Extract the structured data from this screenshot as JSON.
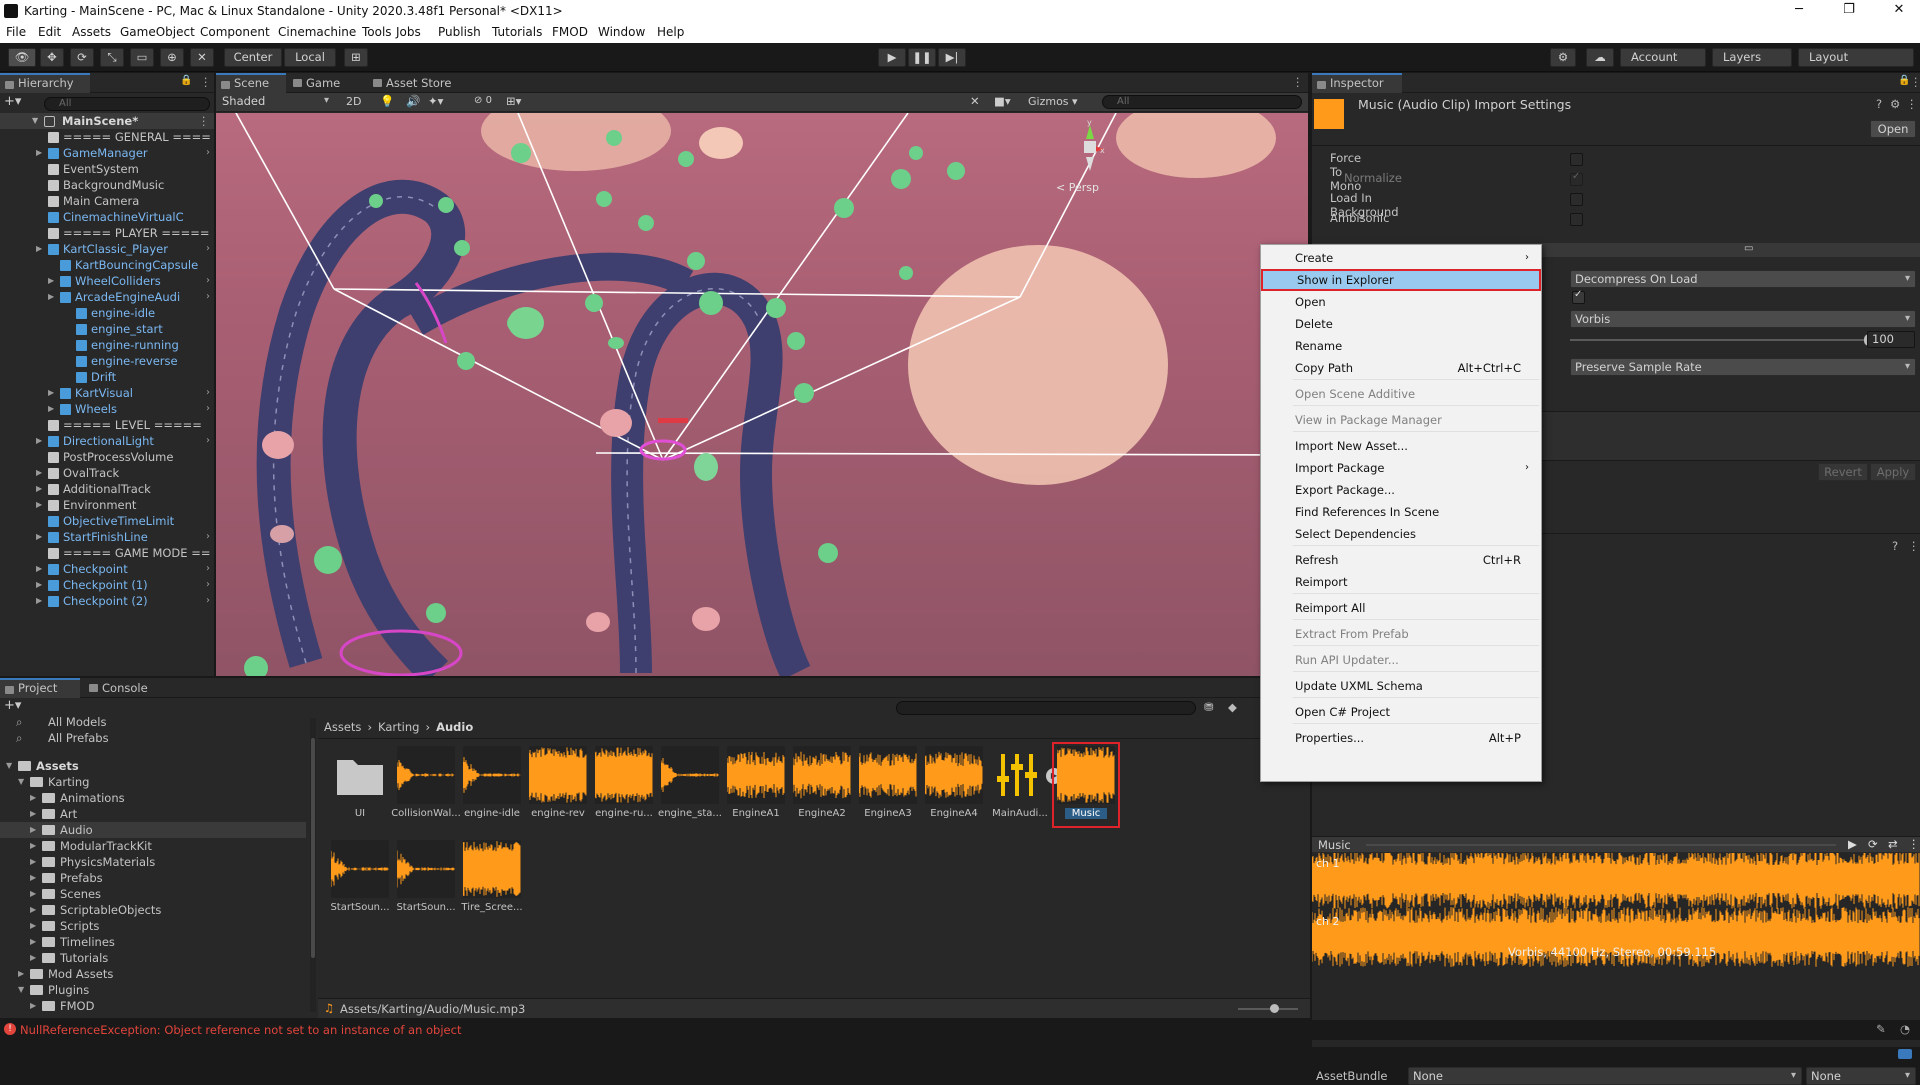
{
  "window": {
    "title": "Karting - MainScene - PC, Mac & Linux Standalone - Unity 2020.3.48f1 Personal* <DX11>"
  },
  "menu": [
    "File",
    "Edit",
    "Assets",
    "GameObject",
    "Component",
    "Cinemachine",
    "Tools",
    "Jobs",
    "Publish",
    "Tutorials",
    "FMOD",
    "Window",
    "Help"
  ],
  "toolbar": {
    "center": "Center",
    "local": "Local",
    "account": "Account",
    "layers": "Layers",
    "layout": "Layout"
  },
  "hierarchy": {
    "tab": "Hierarchy",
    "search": "All",
    "scene": "MainScene*",
    "items": [
      {
        "label": "===== GENERAL ====",
        "indent": 1,
        "icon": "g",
        "blue": false,
        "arrow": false
      },
      {
        "label": "GameManager",
        "indent": 1,
        "icon": "b",
        "blue": true,
        "arrow": true
      },
      {
        "label": "EventSystem",
        "indent": 1,
        "icon": "g",
        "blue": false,
        "arrow": false
      },
      {
        "label": "BackgroundMusic",
        "indent": 1,
        "icon": "g",
        "blue": false,
        "arrow": false
      },
      {
        "label": "Main Camera",
        "indent": 1,
        "icon": "g",
        "blue": false,
        "arrow": false
      },
      {
        "label": "CinemachineVirtualC",
        "indent": 1,
        "icon": "b",
        "blue": true,
        "arrow": false
      },
      {
        "label": "===== PLAYER =====",
        "indent": 1,
        "icon": "g",
        "blue": false,
        "arrow": false
      },
      {
        "label": "KartClassic_Player",
        "indent": 1,
        "icon": "b",
        "blue": true,
        "arrow": true
      },
      {
        "label": "KartBouncingCapsule",
        "indent": 2,
        "icon": "b",
        "blue": true,
        "arrow": false
      },
      {
        "label": "WheelColliders",
        "indent": 2,
        "icon": "b",
        "blue": true,
        "arrow": true
      },
      {
        "label": "ArcadeEngineAudi",
        "indent": 2,
        "icon": "b",
        "blue": true,
        "arrow": true
      },
      {
        "label": "engine-idle",
        "indent": 3,
        "icon": "b",
        "blue": true,
        "arrow": false
      },
      {
        "label": "engine_start",
        "indent": 3,
        "icon": "b",
        "blue": true,
        "arrow": false
      },
      {
        "label": "engine-running",
        "indent": 3,
        "icon": "b",
        "blue": true,
        "arrow": false
      },
      {
        "label": "engine-reverse",
        "indent": 3,
        "icon": "b",
        "blue": true,
        "arrow": false
      },
      {
        "label": "Drift",
        "indent": 3,
        "icon": "b",
        "blue": true,
        "arrow": false
      },
      {
        "label": "KartVisual",
        "indent": 2,
        "icon": "b",
        "blue": true,
        "arrow": true
      },
      {
        "label": "Wheels",
        "indent": 2,
        "icon": "b",
        "blue": true,
        "arrow": true
      },
      {
        "label": "===== LEVEL =====",
        "indent": 1,
        "icon": "g",
        "blue": false,
        "arrow": false
      },
      {
        "label": "DirectionalLight",
        "indent": 1,
        "icon": "b",
        "blue": true,
        "arrow": true
      },
      {
        "label": "PostProcessVolume",
        "indent": 1,
        "icon": "g",
        "blue": false,
        "arrow": false
      },
      {
        "label": "OvalTrack",
        "indent": 1,
        "icon": "g",
        "blue": false,
        "arrow": true
      },
      {
        "label": "AdditionalTrack",
        "indent": 1,
        "icon": "g",
        "blue": false,
        "arrow": true
      },
      {
        "label": "Environment",
        "indent": 1,
        "icon": "g",
        "blue": false,
        "arrow": true
      },
      {
        "label": "ObjectiveTimeLimit",
        "indent": 1,
        "icon": "b",
        "blue": true,
        "arrow": false
      },
      {
        "label": "StartFinishLine",
        "indent": 1,
        "icon": "b",
        "blue": true,
        "arrow": true
      },
      {
        "label": "===== GAME MODE ==",
        "indent": 1,
        "icon": "g",
        "blue": false,
        "arrow": false
      },
      {
        "label": "Checkpoint",
        "indent": 1,
        "icon": "b",
        "blue": true,
        "arrow": true
      },
      {
        "label": "Checkpoint (1)",
        "indent": 1,
        "icon": "b",
        "blue": true,
        "arrow": true
      },
      {
        "label": "Checkpoint (2)",
        "indent": 1,
        "icon": "b",
        "blue": true,
        "arrow": true
      }
    ]
  },
  "scene": {
    "tabs": [
      "Scene",
      "Game",
      "Asset Store"
    ],
    "shading": "Shaded",
    "mode2d": "2D",
    "gizmos": "Gizmos",
    "search": "All",
    "persp": "< Persp",
    "fx": "0"
  },
  "project": {
    "tabs": [
      "Project",
      "Console"
    ],
    "favorites": [
      "All Models",
      "All Prefabs"
    ],
    "tree": [
      {
        "label": "Assets",
        "indent": 0,
        "bold": true
      },
      {
        "label": "Karting",
        "indent": 1,
        "bold": false
      },
      {
        "label": "Animations",
        "indent": 2,
        "bold": false
      },
      {
        "label": "Art",
        "indent": 2,
        "bold": false
      },
      {
        "label": "Audio",
        "indent": 2,
        "bold": false
      },
      {
        "label": "ModularTrackKit",
        "indent": 2,
        "bold": false
      },
      {
        "label": "PhysicsMaterials",
        "indent": 2,
        "bold": false
      },
      {
        "label": "Prefabs",
        "indent": 2,
        "bold": false
      },
      {
        "label": "Scenes",
        "indent": 2,
        "bold": false
      },
      {
        "label": "ScriptableObjects",
        "indent": 2,
        "bold": false
      },
      {
        "label": "Scripts",
        "indent": 2,
        "bold": false
      },
      {
        "label": "Timelines",
        "indent": 2,
        "bold": false
      },
      {
        "label": "Tutorials",
        "indent": 2,
        "bold": false
      },
      {
        "label": "Mod Assets",
        "indent": 1,
        "bold": false
      },
      {
        "label": "Plugins",
        "indent": 1,
        "bold": false
      },
      {
        "label": "FMOD",
        "indent": 2,
        "bold": false
      }
    ],
    "breadcrumb": [
      "Assets",
      "Karting",
      "Audio"
    ],
    "assets": [
      {
        "label": "UI",
        "kind": "folder"
      },
      {
        "label": "CollisionWal...",
        "kind": "short"
      },
      {
        "label": "engine-idle",
        "kind": "short"
      },
      {
        "label": "engine-rev",
        "kind": "full"
      },
      {
        "label": "engine-ru...",
        "kind": "full"
      },
      {
        "label": "engine_sta...",
        "kind": "short"
      },
      {
        "label": "EngineA1",
        "kind": "dense"
      },
      {
        "label": "EngineA2",
        "kind": "dense"
      },
      {
        "label": "EngineA3",
        "kind": "dense"
      },
      {
        "label": "EngineA4",
        "kind": "dense"
      },
      {
        "label": "MainAudi...",
        "kind": "mixer"
      },
      {
        "label": "Music",
        "kind": "music"
      },
      {
        "label": "StartSoun...",
        "kind": "short"
      },
      {
        "label": "StartSoun...",
        "kind": "short"
      },
      {
        "label": "Tire_Scree...",
        "kind": "full"
      }
    ],
    "path": "Assets/Karting/Audio/Music.mp3"
  },
  "inspector": {
    "tab": "Inspector",
    "title": "Music (Audio Clip) Import Settings",
    "open": "Open",
    "rows": [
      {
        "label": "Force To Mono",
        "checked": false,
        "dim": false
      },
      {
        "label": "Normalize",
        "checked": true,
        "dim": true
      },
      {
        "label": "Load In Background",
        "checked": false,
        "dim": false
      },
      {
        "label": "Ambisonic",
        "checked": false,
        "dim": false
      }
    ],
    "loadType": "Decompress On Load",
    "format": "Vorbis",
    "quality": "100",
    "sampleRate": "Preserve Sample Rate",
    "revert": "Revert",
    "apply": "Apply",
    "preview": {
      "title": "Music",
      "ch1": "ch 1",
      "ch2": "ch 2",
      "info": "Vorbis, 44100 Hz, Stereo, 00:59.115"
    },
    "assetbundle": {
      "label": "AssetBundle",
      "value": "None",
      "variant": "None"
    }
  },
  "context_menu": {
    "items": [
      {
        "label": "Create",
        "shortcut": "",
        "sub": true,
        "dis": false,
        "sep": false
      },
      {
        "label": "Show in Explorer",
        "shortcut": "",
        "sub": false,
        "dis": false,
        "sep": false,
        "hl": true
      },
      {
        "label": "Open",
        "shortcut": "",
        "sub": false,
        "dis": false,
        "sep": false
      },
      {
        "label": "Delete",
        "shortcut": "",
        "sub": false,
        "dis": false,
        "sep": false
      },
      {
        "label": "Rename",
        "shortcut": "",
        "sub": false,
        "dis": false,
        "sep": false
      },
      {
        "label": "Copy Path",
        "shortcut": "Alt+Ctrl+C",
        "sub": false,
        "dis": false,
        "sep": true
      },
      {
        "label": "Open Scene Additive",
        "shortcut": "",
        "sub": false,
        "dis": true,
        "sep": true
      },
      {
        "label": "View in Package Manager",
        "shortcut": "",
        "sub": false,
        "dis": true,
        "sep": true
      },
      {
        "label": "Import New Asset...",
        "shortcut": "",
        "sub": false,
        "dis": false,
        "sep": false
      },
      {
        "label": "Import Package",
        "shortcut": "",
        "sub": true,
        "dis": false,
        "sep": false
      },
      {
        "label": "Export Package...",
        "shortcut": "",
        "sub": false,
        "dis": false,
        "sep": false
      },
      {
        "label": "Find References In Scene",
        "shortcut": "",
        "sub": false,
        "dis": false,
        "sep": false
      },
      {
        "label": "Select Dependencies",
        "shortcut": "",
        "sub": false,
        "dis": false,
        "sep": true
      },
      {
        "label": "Refresh",
        "shortcut": "Ctrl+R",
        "sub": false,
        "dis": false,
        "sep": false
      },
      {
        "label": "Reimport",
        "shortcut": "",
        "sub": false,
        "dis": false,
        "sep": true
      },
      {
        "label": "Reimport All",
        "shortcut": "",
        "sub": false,
        "dis": false,
        "sep": true
      },
      {
        "label": "Extract From Prefab",
        "shortcut": "",
        "sub": false,
        "dis": true,
        "sep": true
      },
      {
        "label": "Run API Updater...",
        "shortcut": "",
        "sub": false,
        "dis": true,
        "sep": true
      },
      {
        "label": "Update UXML Schema",
        "shortcut": "",
        "sub": false,
        "dis": false,
        "sep": true
      },
      {
        "label": "Open C# Project",
        "shortcut": "",
        "sub": false,
        "dis": false,
        "sep": true
      },
      {
        "label": "Properties...",
        "shortcut": "Alt+P",
        "sub": false,
        "dis": false,
        "sep": false
      }
    ]
  },
  "status": {
    "error": "NullReferenceException: Object reference not set to an instance of an object"
  },
  "colors": {
    "accent": "#3a79bb",
    "error": "#e2453c",
    "waveform": "#ff9a1a",
    "highlight": "#e0222a"
  }
}
